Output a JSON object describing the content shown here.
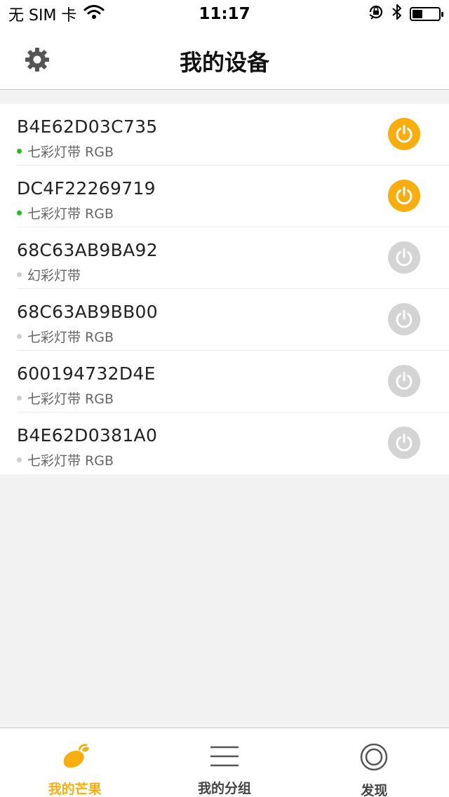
{
  "status_bar": {
    "carrier": "无 SIM 卡",
    "time": "11:17"
  },
  "header": {
    "title": "我的设备",
    "settings_icon": "gear-icon"
  },
  "devices": [
    {
      "name": "B4E62D03C735",
      "type": "七彩灯带 RGB",
      "online": true,
      "power": "on"
    },
    {
      "name": "DC4F22269719",
      "type": "七彩灯带 RGB",
      "online": true,
      "power": "on"
    },
    {
      "name": "68C63AB9BA92",
      "type": "幻彩灯带",
      "online": false,
      "power": "off"
    },
    {
      "name": "68C63AB9BB00",
      "type": "七彩灯带 RGB",
      "online": false,
      "power": "off"
    },
    {
      "name": "600194732D4E",
      "type": "七彩灯带 RGB",
      "online": false,
      "power": "off"
    },
    {
      "name": "B4E62D0381A0",
      "type": "七彩灯带 RGB",
      "online": false,
      "power": "off"
    }
  ],
  "tabs": [
    {
      "label": "我的芒果",
      "icon": "mango-icon",
      "active": true
    },
    {
      "label": "我的分组",
      "icon": "list-icon",
      "active": false
    },
    {
      "label": "发现",
      "icon": "discover-icon",
      "active": false
    }
  ],
  "colors": {
    "accent": "#f9ae10",
    "online": "#2bb52b",
    "offline": "#cfcfcf",
    "power_off": "#d4d4d4"
  }
}
